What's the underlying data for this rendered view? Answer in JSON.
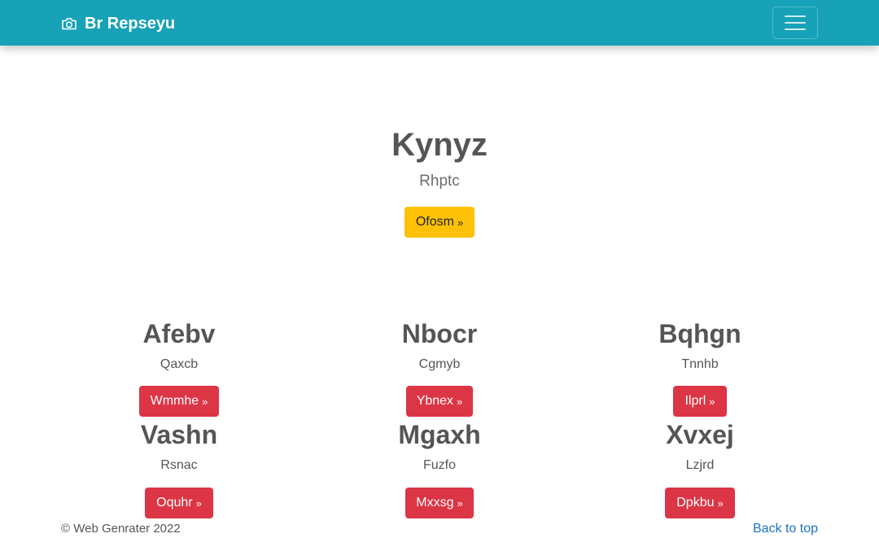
{
  "navbar": {
    "brand": "Br Repseyu",
    "brand_icon": "camera-icon",
    "toggler_icon": "hamburger-menu-icon",
    "background": "#17a2b8"
  },
  "hero": {
    "title": "Kynyz",
    "subtitle": "Rhptc",
    "button_label": "Ofosm",
    "button_color": "#ffc107"
  },
  "cards": [
    {
      "title": "Afebv",
      "subtitle": "Qaxcb",
      "button_label": "Wmmhe"
    },
    {
      "title": "Nbocr",
      "subtitle": "Cgmyb",
      "button_label": "Ybnex"
    },
    {
      "title": "Bqhgn",
      "subtitle": "Tnnhb",
      "button_label": "Ilprl"
    },
    {
      "title": "Vashn",
      "subtitle": "Rsnac",
      "button_label": "Oquhr"
    },
    {
      "title": "Mgaxh",
      "subtitle": "Fuzfo",
      "button_label": "Mxxsg"
    },
    {
      "title": "Xvxej",
      "subtitle": "Lzjrd",
      "button_label": "Dpkbu"
    }
  ],
  "card_button_color": "#dc3545",
  "button_suffix": "»",
  "footer": {
    "copyright": "© Web Genrater 2022",
    "back_to_top": "Back to top",
    "link_color": "#1e73be"
  }
}
